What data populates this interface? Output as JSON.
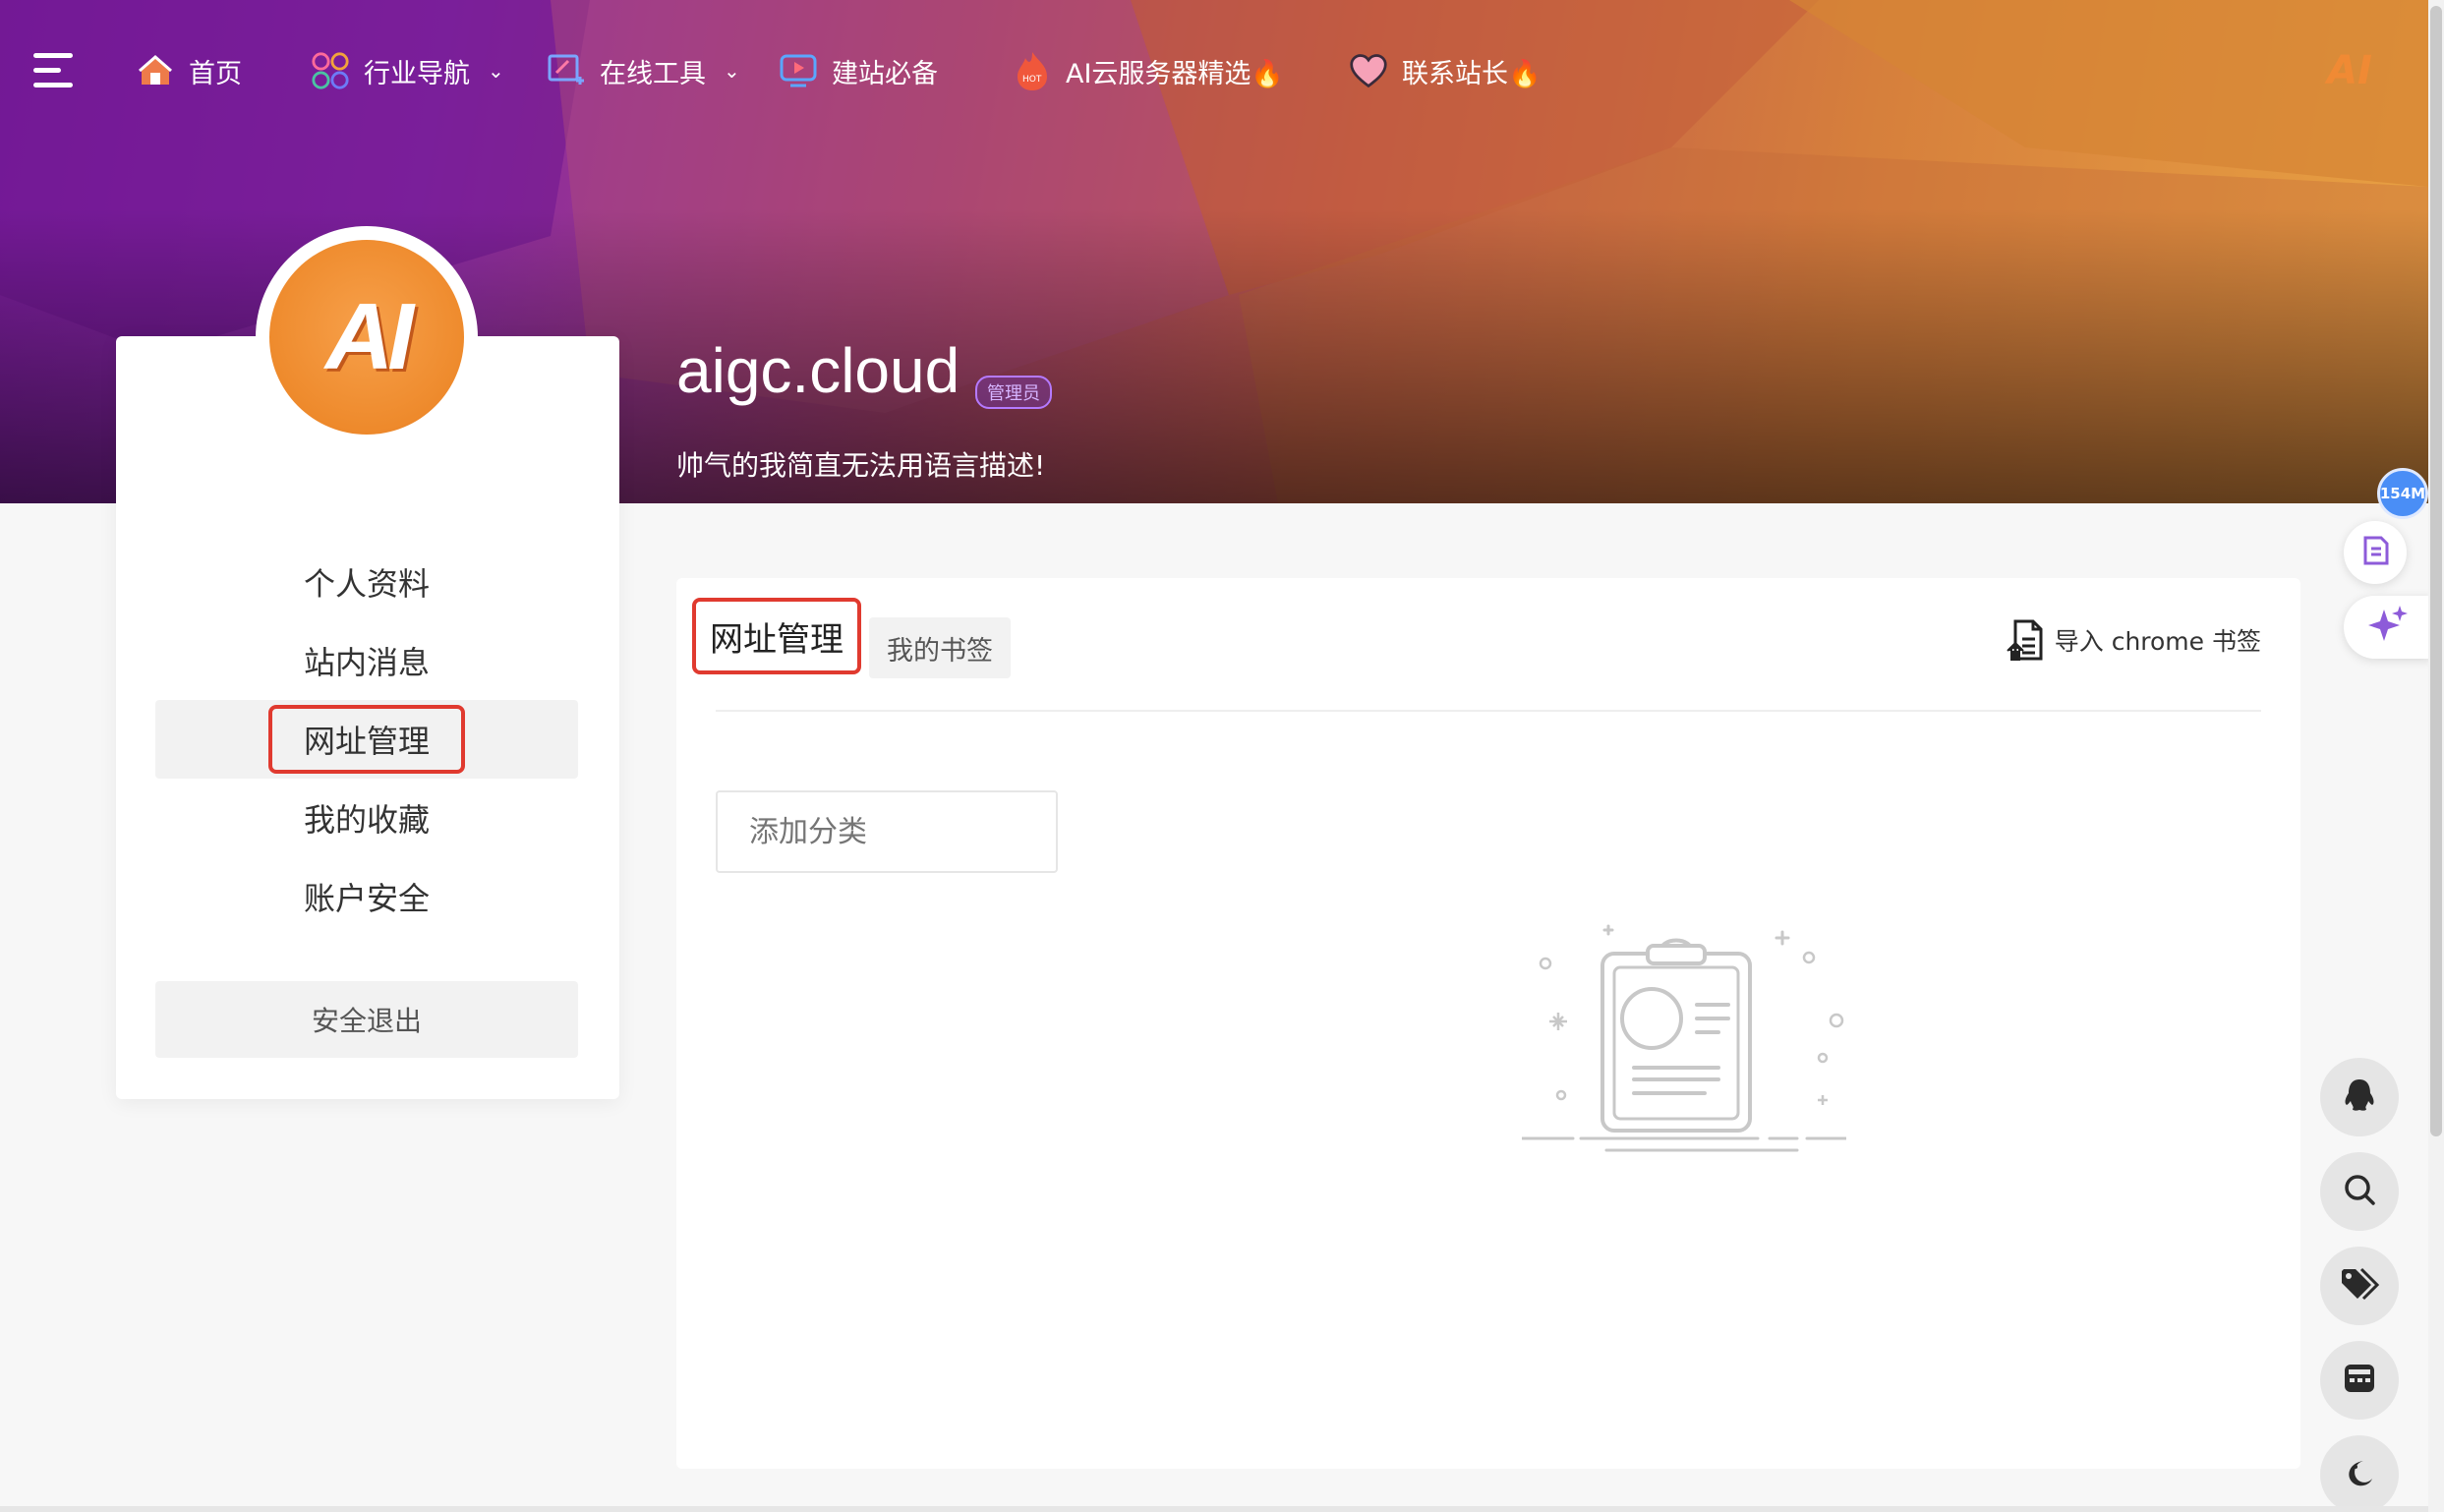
{
  "nav": {
    "items": [
      {
        "label": "首页"
      },
      {
        "label": "行业导航"
      },
      {
        "label": "在线工具"
      },
      {
        "label": "建站必备"
      },
      {
        "label": "AI云服务器精选🔥"
      },
      {
        "label": "联系站长🔥"
      }
    ],
    "brand_mini": "AI",
    "icons": [
      "menu-icon",
      "home-icon",
      "apps-icon",
      "tools-icon",
      "play-icon",
      "hot-fire-icon",
      "heart-icon"
    ]
  },
  "profile": {
    "avatar_text": "AI",
    "name": "aigc.cloud",
    "role": "管理员",
    "bio": "帅气的我简直无法用语言描述!"
  },
  "sidebar": {
    "items": [
      {
        "label": "个人资料"
      },
      {
        "label": "站内消息"
      },
      {
        "label": "网址管理"
      },
      {
        "label": "我的收藏"
      },
      {
        "label": "账户安全"
      }
    ],
    "active_index": 2,
    "logout_label": "安全退出"
  },
  "main": {
    "tabs": [
      {
        "label": "网址管理"
      },
      {
        "label": "我的书签"
      }
    ],
    "import_label": "导入 chrome 书签",
    "add_category_placeholder": "添加分类"
  },
  "float": {
    "badge": "154M"
  },
  "colors": {
    "accent_red": "#e03a2f",
    "badge_blue": "#4a8ef6",
    "purple": "#8d5bd9",
    "orange": "#ee8a2c"
  }
}
